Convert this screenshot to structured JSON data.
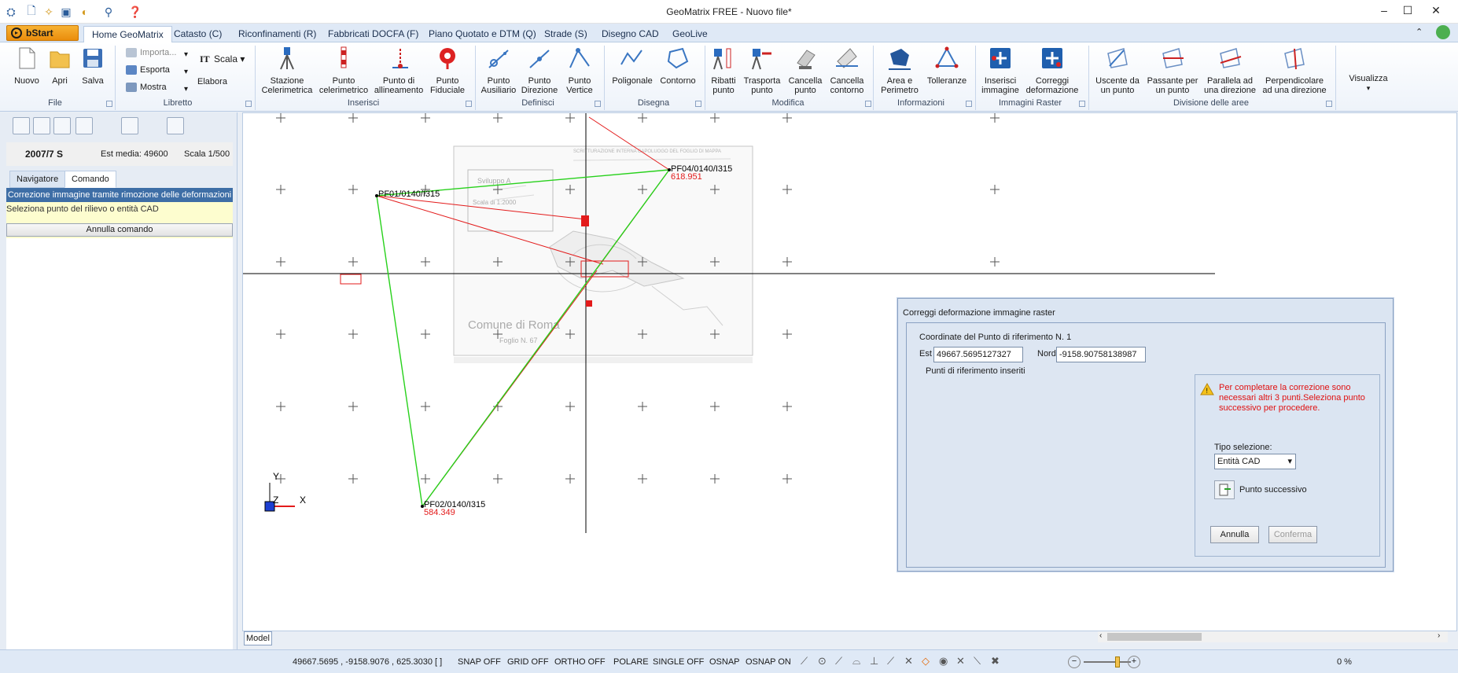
{
  "window": {
    "title": "GeoMatrix FREE - Nuovo file*"
  },
  "tabs": {
    "start": "bStart",
    "items": [
      "Home GeoMatrix",
      "Catasto (C)",
      "Riconfinamenti (R)",
      "Fabbricati DOCFA (F)",
      "Piano Quotato e DTM (Q)",
      "Strade (S)",
      "Disegno CAD",
      "GeoLive"
    ]
  },
  "ribbon": {
    "file": {
      "label": "File",
      "nuovo": "Nuovo",
      "apri": "Apri",
      "salva": "Salva"
    },
    "libretto": {
      "label": "Libretto",
      "importa": "Importa...",
      "esporta": "Esporta",
      "mostra": "Mostra",
      "scala": "Scala",
      "elabora": "Elabora"
    },
    "inserisci": {
      "label": "Inserisci",
      "b1a": "Stazione",
      "b1b": "Celerimetrica",
      "b2a": "Punto",
      "b2b": "celerimetrico",
      "b3a": "Punto di",
      "b3b": "allineamento",
      "b4a": "Punto",
      "b4b": "Fiduciale"
    },
    "definisci": {
      "label": "Definisci",
      "b1a": "Punto",
      "b1b": "Ausiliario",
      "b2a": "Punto",
      "b2b": "Direzione",
      "b3a": "Punto",
      "b3b": "Vertice"
    },
    "disegna": {
      "label": "Disegna",
      "b1": "Poligonale",
      "b2": "Contorno"
    },
    "modifica": {
      "label": "Modifica",
      "b1a": "Ribatti",
      "b1b": "punto",
      "b2a": "Trasporta",
      "b2b": "punto",
      "b3a": "Cancella",
      "b3b": "punto",
      "b4a": "Cancella",
      "b4b": "contorno"
    },
    "informazioni": {
      "label": "Informazioni",
      "b1a": "Area e",
      "b1b": "Perimetro",
      "b2": "Tolleranze"
    },
    "immagini": {
      "label": "Immagini Raster",
      "b1a": "Inserisci",
      "b1b": "immagine",
      "b2a": "Correggi",
      "b2b": "deformazione"
    },
    "divisione": {
      "label": "Divisione delle aree",
      "b1a": "Uscente da",
      "b1b": "un punto",
      "b2a": "Passante per",
      "b2b": "un punto",
      "b3a": "Parallela ad",
      "b3b": "una direzione",
      "b4a": "Perpendicolare",
      "b4b": "ad una direzione"
    },
    "visualizza": "Visualizza"
  },
  "leftpanel": {
    "sheet": "2007/7 S",
    "est_media": "Est media: 49600",
    "scala": "Scala 1/500",
    "tab_navigatore": "Navigatore",
    "tab_comando": "Comando",
    "cmd_title": "Correzione immagine tramite rimozione delle deformazioni",
    "cmd_prompt": "Seleziona punto del rilievo o entità CAD",
    "annulla": "Annulla comando"
  },
  "canvas": {
    "labels": {
      "pf01": "PF01/0140/I315",
      "pf04": "PF04/0140/I315",
      "pf04_q": "618.951",
      "pf02": "PF02/0140/I315",
      "pf02_q": "584.349"
    },
    "raster": {
      "comune": "Comune di Roma",
      "foglio": "Foglio N. 67",
      "scrittura": "SCRITTURAZIONE INTERNA CAPOLUOGO DEL FOGLIO DI MAPPA",
      "sviluppo": "Sviluppo A",
      "scala": "Scala di 1:2000"
    },
    "axis_y": "Y",
    "axis_z": "Z",
    "axis_x": "X",
    "model_tab": "Model"
  },
  "dialog": {
    "title": "Correggi deformazione immagine raster",
    "group": "Coordinate del Punto di riferimento N. 1",
    "est_label": "Est",
    "est_value": "49667.5695127327",
    "nord_label": "Nord",
    "nord_value": "-9158.90758138987",
    "inseriti": "Punti di riferimento inseriti",
    "warning": "Per completare la correzione sono necessari altri 3 punti.Seleziona punto successivo per procedere.",
    "tipo_label": "Tipo selezione:",
    "tipo_value": "Entità CAD",
    "next": "Punto successivo",
    "annulla": "Annulla",
    "conferma": "Conferma"
  },
  "status": {
    "coords": "49667.5695 , -9158.9076 , 625.3030 [ ]",
    "snap": "SNAP OFF",
    "grid": "GRID OFF",
    "ortho": "ORTHO OFF",
    "polare": "POLARE",
    "single": "SINGLE OFF",
    "osnap": "OSNAP",
    "osnap_on": "OSNAP ON",
    "zoom": "0 %"
  }
}
